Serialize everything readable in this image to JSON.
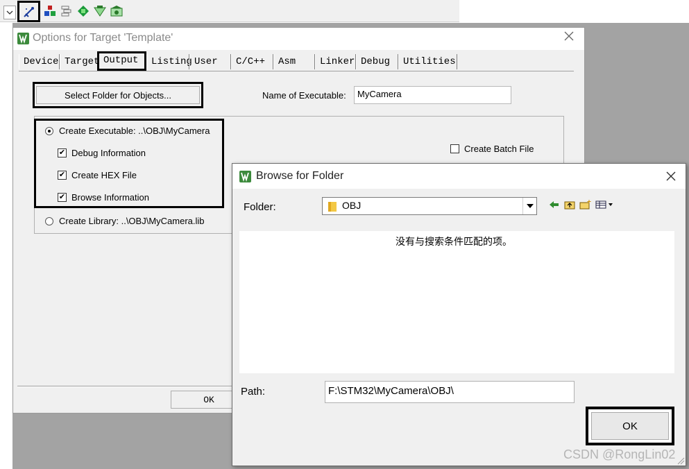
{
  "toolbar": {
    "icons": [
      "options-for-target-icon",
      "manage-components-icon",
      "file-extensions-icon",
      "select-packs-icon",
      "pack-installer-icon",
      "run-time-environment-icon"
    ]
  },
  "options_dialog": {
    "title": "Options for Target 'Template'",
    "tabs": [
      "Device",
      "Target",
      "Output",
      "Listing",
      "User",
      "C/C++",
      "Asm",
      "Linker",
      "Debug",
      "Utilities"
    ],
    "active_tab": "Output",
    "select_folder_label": "Select Folder for Objects...",
    "name_of_executable_label": "Name of Executable:",
    "name_of_executable_value": "MyCamera",
    "create_executable_label": "Create Executable:  ..\\OBJ\\MyCamera",
    "debug_info_label": "Debug Information",
    "create_hex_label": "Create HEX File",
    "browse_info_label": "Browse Information",
    "create_library_label": "Create Library:  ..\\OBJ\\MyCamera.lib",
    "create_batch_label": "Create Batch File",
    "ok_label": "OK",
    "create_executable_selected": true,
    "debug_info_checked": true,
    "create_hex_checked": true,
    "browse_info_checked": true,
    "create_batch_checked": false
  },
  "browse_dialog": {
    "title": "Browse for Folder",
    "folder_label": "Folder:",
    "folder_value": "OBJ",
    "empty_message": "没有与搜索条件匹配的项。",
    "path_label": "Path:",
    "path_value": "F:\\STM32\\MyCamera\\OBJ\\",
    "ok_label": "OK"
  },
  "watermark": "CSDN @RongLin02",
  "colors": {
    "highlight_border": "#000000",
    "dialog_bg": "#f0f0f0",
    "desktop_bg": "#a3a3a3",
    "keil_icon_green": "#3c8a3c"
  }
}
